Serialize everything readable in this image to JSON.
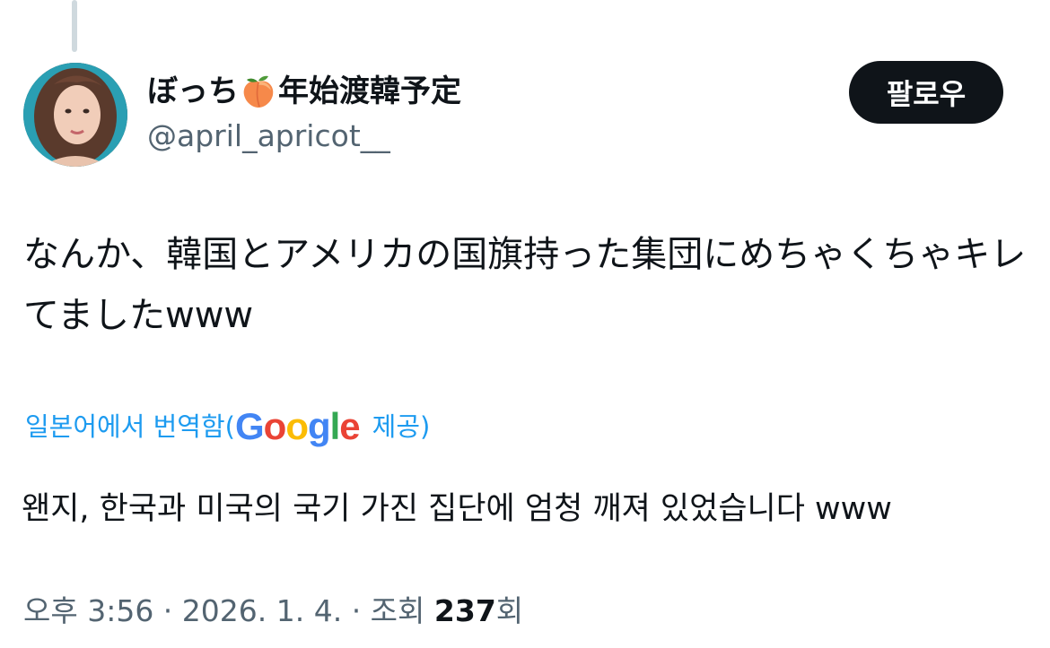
{
  "author": {
    "display_name_prefix": "ぼっち",
    "emoji_icon": "peach-icon",
    "display_name_suffix": "年始渡韓予定",
    "handle": "@april_apricot__"
  },
  "follow_button": {
    "label": "팔로우"
  },
  "tweet": {
    "text_line1": "なんか、韓国とアメリカの国旗持った集団にめちゃくちゃキレ",
    "text_line2": "てましたwww"
  },
  "translation": {
    "prefix": "일본어에서 번역함(",
    "google_G": "G",
    "google_o1": "o",
    "google_o2": "o",
    "google_g": "g",
    "google_l": "l",
    "google_e": "e",
    "suffix": "제공)",
    "translated_text": "왠지, 한국과 미국의 국기 가진 집단에 엄청 깨져 있었습니다 www"
  },
  "meta": {
    "time_date": "오후 3:56 · 2026. 1. 4. · 조회 ",
    "views_count": "237",
    "views_suffix": "회"
  },
  "colors": {
    "link_blue": "#1d9bf0",
    "text_primary": "#0f1419",
    "text_secondary": "#536471",
    "google_blue": "#4285f4",
    "google_red": "#ea4335",
    "google_yellow": "#fbbc05",
    "google_green": "#34a853"
  }
}
